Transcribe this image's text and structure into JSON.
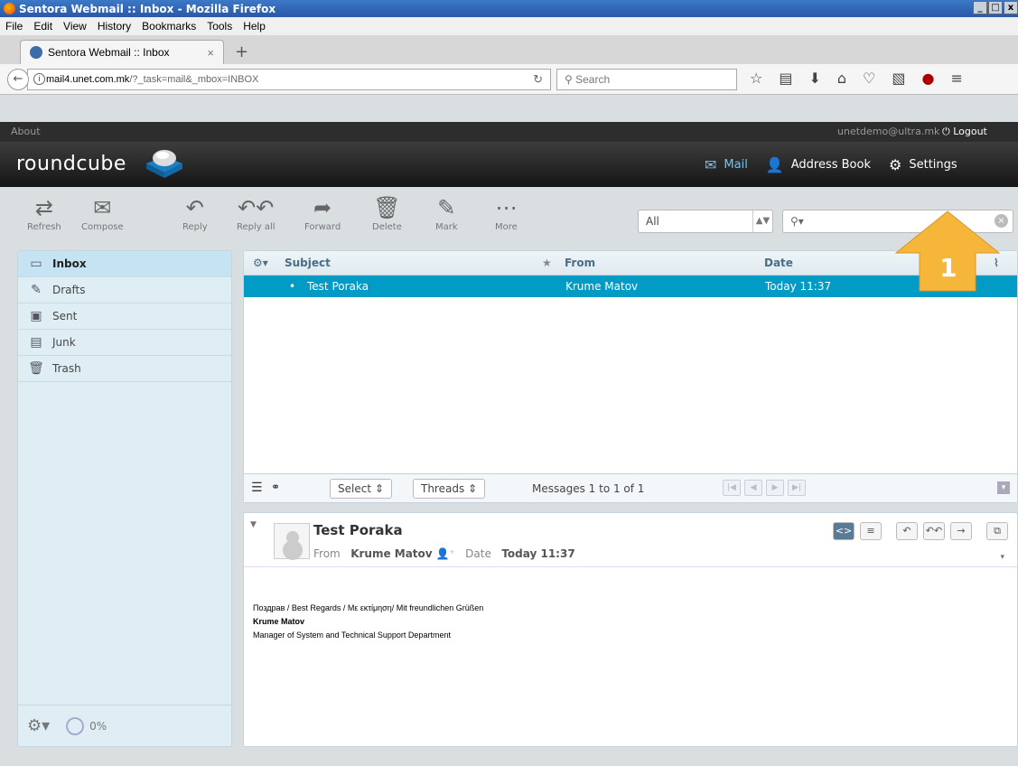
{
  "window": {
    "title": "Sentora Webmail :: Inbox - Mozilla Firefox",
    "controls": [
      "_",
      "□",
      "x"
    ]
  },
  "menu": [
    "File",
    "Edit",
    "View",
    "History",
    "Bookmarks",
    "Tools",
    "Help"
  ],
  "tab": {
    "title": "Sentora Webmail :: Inbox",
    "close": "×",
    "new_tab": "+"
  },
  "nav": {
    "url_host": "mail4.unet.com.mk",
    "url_path": "/?_task=mail&_mbox=INBOX",
    "search_placeholder": "Search"
  },
  "topline": {
    "about": "About",
    "user": "unetdemo@ultra.mk",
    "logout": "Logout"
  },
  "header": {
    "logo": "roundcube",
    "nav": [
      "Mail",
      "Address Book",
      "Settings"
    ]
  },
  "toolbar": {
    "buttons": [
      "Refresh",
      "Compose",
      "Reply",
      "Reply all",
      "Forward",
      "Delete",
      "Mark",
      "More"
    ]
  },
  "filter": {
    "value": "All"
  },
  "folders": [
    "Inbox",
    "Drafts",
    "Sent",
    "Junk",
    "Trash"
  ],
  "quota": "0%",
  "list": {
    "headers": {
      "subject": "Subject",
      "from": "From",
      "date": "Date"
    },
    "rows": [
      {
        "subject": "Test Poraka",
        "from": "Krume Matov",
        "date": "Today 11:37"
      }
    ],
    "select": "Select",
    "threads": "Threads",
    "count": "Messages 1 to 1 of 1"
  },
  "preview": {
    "subject": "Test Poraka",
    "from_label": "From",
    "from": "Krume Matov",
    "date_label": "Date",
    "date": "Today 11:37",
    "body_line1": "Поздрав / Best Regards / Με εκτίμηση/ Mit freundlichen Grüßen",
    "body_name": "Krume Matov",
    "body_title": "Manager of System and Technical Support Department"
  },
  "callout": {
    "number": "1",
    "color": "#f6b63a"
  }
}
